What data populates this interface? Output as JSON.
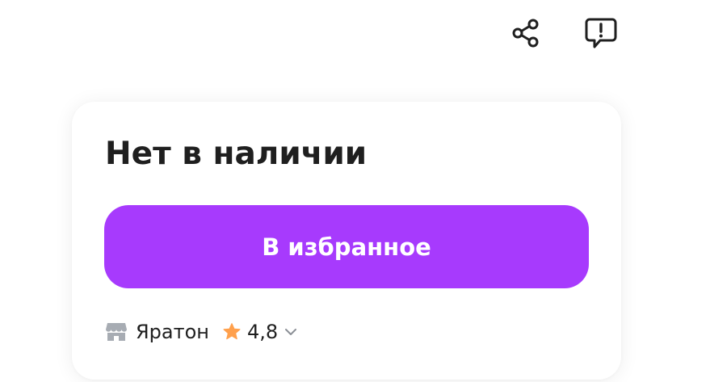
{
  "header": {
    "share_icon": "share-icon",
    "report_icon": "report-problem-icon"
  },
  "card": {
    "availability": "Нет в наличии",
    "favorite_button_label": "В избранное",
    "seller": {
      "store_icon": "store-icon",
      "name": "Яратон",
      "rating": "4,8",
      "star_icon": "star-icon",
      "chevron_icon": "chevron-down-icon"
    }
  },
  "colors": {
    "accent": "#a73afd",
    "text": "#1f1f1f",
    "star": "#ffa04c",
    "store_icon": "#a7acb3",
    "chevron": "#8b8f96"
  }
}
